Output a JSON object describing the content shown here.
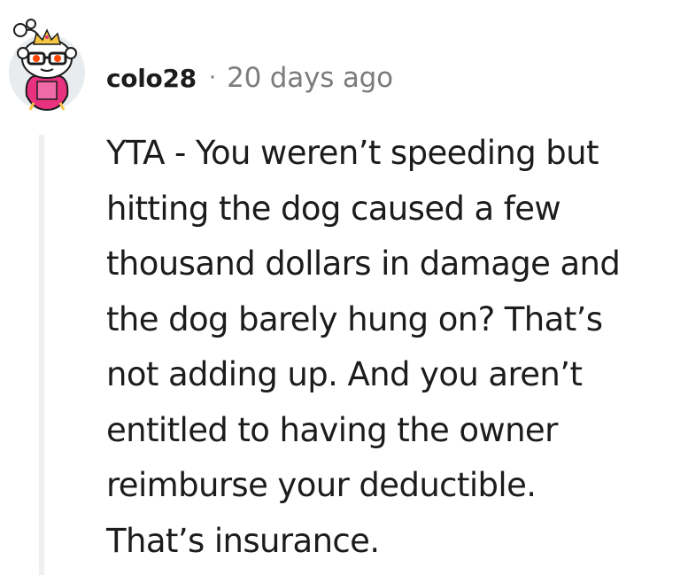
{
  "comment": {
    "username": "colo28",
    "separator": "·",
    "timestamp": "20 days ago",
    "body_lines": [
      "YTA - You weren’t speeding but",
      "hitting the dog caused a few",
      "thousand dollars in damage and",
      "the dog barely hung on? That’s",
      "not adding up. And you aren’t",
      "entitled to having the owner",
      "reimburse your deductible.",
      "That’s insurance."
    ],
    "avatar_icon": "snoo-avatar-icon"
  },
  "colors": {
    "text": "#1c1c1c",
    "meta": "#7c7c7c",
    "thread_line": "#edeff1",
    "avatar_bg": "#e8ecef",
    "avatar_outfit": "#e8317f",
    "avatar_crown": "#f5c542",
    "avatar_eyes": "#ff4500"
  }
}
